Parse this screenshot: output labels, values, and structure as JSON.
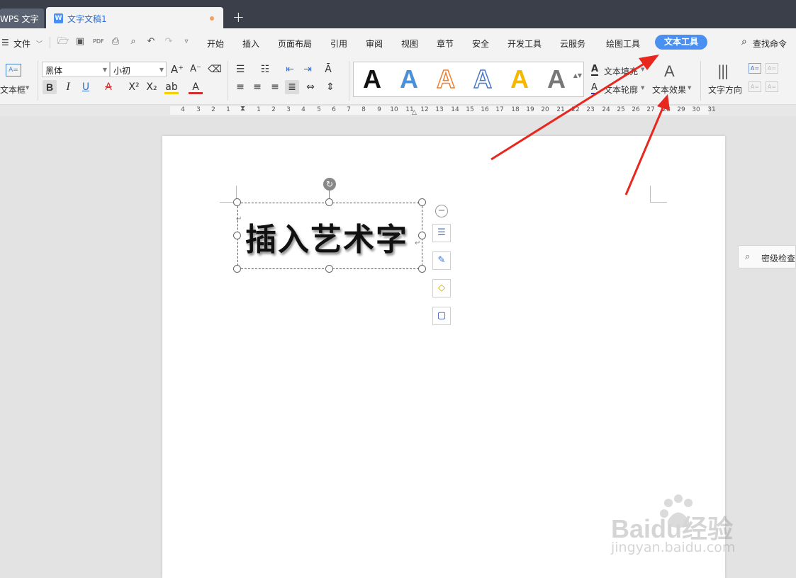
{
  "tabs": {
    "app_tab": "WPS 文字",
    "doc_tab": "文字文稿1",
    "doc_icon": "W",
    "new_tab": "+"
  },
  "menu": {
    "file": "文件",
    "items": [
      "开始",
      "插入",
      "页面布局",
      "引用",
      "审阅",
      "视图",
      "章节",
      "安全",
      "开发工具",
      "云服务",
      "绘图工具"
    ],
    "active": "文本工具",
    "search": "查找命令"
  },
  "ribbon": {
    "textbox_label": "文本框",
    "font_name": "黑体",
    "font_size": "小初",
    "text_fill": "文本填充",
    "text_outline": "文本轮廓",
    "text_effect": "文本效果",
    "text_direction": "文字方向",
    "style_letter": "A",
    "style_colors": [
      "#111111",
      "#4a90d9",
      "#f08030",
      "#4a78c8",
      "#f5b800",
      "#777777"
    ]
  },
  "ruler": {
    "numbers": [
      "4",
      "3",
      "2",
      "1",
      "1",
      "2",
      "3",
      "4",
      "5",
      "6",
      "7",
      "8",
      "9",
      "10",
      "11",
      "12",
      "13",
      "14",
      "15",
      "16",
      "17",
      "18",
      "19",
      "20",
      "21",
      "22",
      "23",
      "24",
      "25",
      "26",
      "27",
      "28",
      "29",
      "30",
      "31"
    ]
  },
  "document": {
    "wordart_text": "插入艺术字"
  },
  "side_panel": {
    "secret_check": "密级检查"
  },
  "watermark": {
    "brand": "Baidu经验",
    "url": "jingyan.baidu.com"
  },
  "colors": {
    "accent": "#4a90f0",
    "arrow": "#e8271e",
    "titlebar": "#3b3f4a"
  }
}
